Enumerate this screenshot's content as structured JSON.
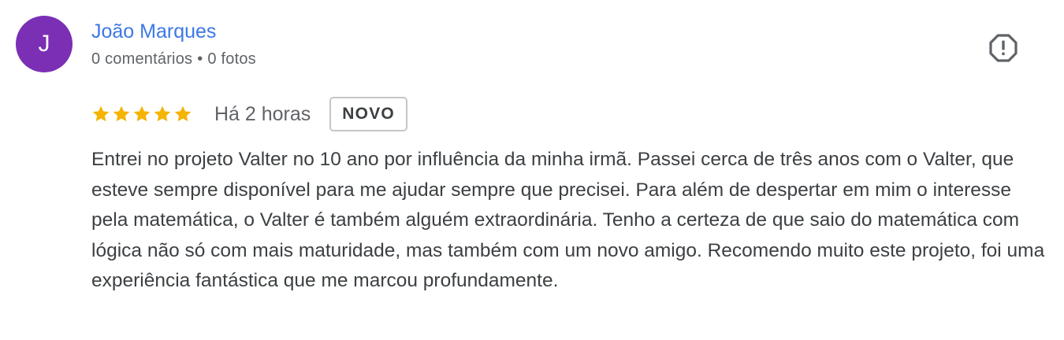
{
  "reviewer": {
    "initial": "J",
    "avatar_color": "#7b2fb4",
    "name": "João Marques",
    "comments": "0 comentários",
    "separator": "•",
    "photos": "0 fotos"
  },
  "report_icon": "report-flag-icon",
  "rating": {
    "stars": 5,
    "max_stars": 5,
    "star_color": "#f4b400",
    "time": "Há 2 horas",
    "badge": "NOVO"
  },
  "review_text": "Entrei no projeto Valter no 10 ano por influência da minha irmã. Passei cerca de três anos com o Valter, que esteve sempre disponível para me ajudar sempre que precisei. Para além de despertar em mim o interesse pela matemática, o Valter é também alguém extraordinária. Tenho a certeza de que saio do matemática com lógica não só com mais maturidade, mas também com um novo amigo. Recomendo muito este projeto, foi uma experiência fantástica que me marcou profundamente."
}
